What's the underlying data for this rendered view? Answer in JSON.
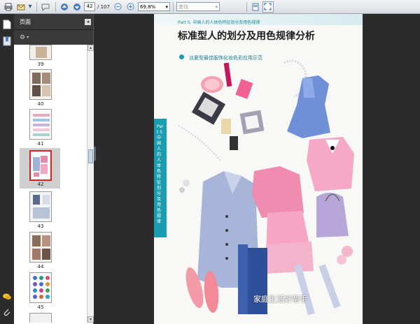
{
  "toolbar": {
    "page_current": "42",
    "page_total": "/ 107",
    "zoom": "69.8%",
    "find_placeholder": "查找"
  },
  "panel": {
    "title": "页面"
  },
  "thumbnails": [
    {
      "label": "39"
    },
    {
      "label": "40"
    },
    {
      "label": "41"
    },
    {
      "label": "42"
    },
    {
      "label": "43"
    },
    {
      "label": "44"
    },
    {
      "label": "45"
    }
  ],
  "document": {
    "part_line": "Part 5.  中国人的人体色特征划分及用色规律",
    "title": "标准型人的划分及用色规律分析",
    "subtitle": "淡夏型最佳服饰化妆色彩应用示范",
    "side_tab": "Part 5.  中国人的人体色特征划分及用色规律",
    "footer": "家庭生活好帮手"
  },
  "colors": {
    "accent_teal": "#1b9cb0",
    "panel_dark": "#3a3a3a",
    "background_dark": "#2b2b2b"
  }
}
